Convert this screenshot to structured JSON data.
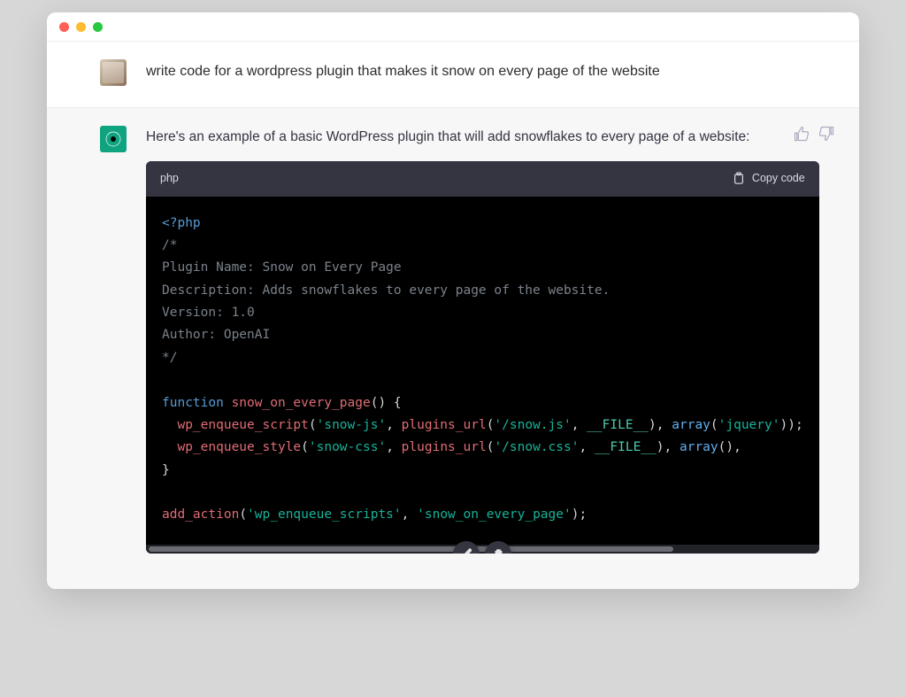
{
  "window": {
    "traffic": [
      "close",
      "minimize",
      "zoom"
    ]
  },
  "user": {
    "text": "write code for a wordpress plugin that makes it snow on every page of the website"
  },
  "assistant": {
    "intro": "Here's an example of a basic WordPress plugin that will add snowflakes to every page of a website:",
    "code": {
      "language": "php",
      "copy_label": "Copy code",
      "tokens": [
        {
          "t": "tag",
          "v": "<?php"
        },
        {
          "t": "nl"
        },
        {
          "t": "cm",
          "v": "/*"
        },
        {
          "t": "nl"
        },
        {
          "t": "cm",
          "v": "Plugin Name: Snow on Every Page"
        },
        {
          "t": "nl"
        },
        {
          "t": "cm",
          "v": "Description: Adds snowflakes to every page of the website."
        },
        {
          "t": "nl"
        },
        {
          "t": "cm",
          "v": "Version: 1.0"
        },
        {
          "t": "nl"
        },
        {
          "t": "cm",
          "v": "Author: OpenAI"
        },
        {
          "t": "nl"
        },
        {
          "t": "cm",
          "v": "*/"
        },
        {
          "t": "nl"
        },
        {
          "t": "nl"
        },
        {
          "t": "kw",
          "v": "function"
        },
        {
          "t": "sp"
        },
        {
          "t": "fn",
          "v": "snow_on_every_page"
        },
        {
          "t": "punct",
          "v": "()"
        },
        {
          "t": "sp"
        },
        {
          "t": "punct",
          "v": "{"
        },
        {
          "t": "nl"
        },
        {
          "t": "indent"
        },
        {
          "t": "call",
          "v": "wp_enqueue_script"
        },
        {
          "t": "punct",
          "v": "("
        },
        {
          "t": "str",
          "v": "'snow-js'"
        },
        {
          "t": "punct",
          "v": ", "
        },
        {
          "t": "call",
          "v": "plugins_url"
        },
        {
          "t": "punct",
          "v": "("
        },
        {
          "t": "str",
          "v": "'/snow.js'"
        },
        {
          "t": "punct",
          "v": ", "
        },
        {
          "t": "const",
          "v": "__FILE__"
        },
        {
          "t": "punct",
          "v": "), "
        },
        {
          "t": "id",
          "v": "array"
        },
        {
          "t": "punct",
          "v": "("
        },
        {
          "t": "str",
          "v": "'jquery'"
        },
        {
          "t": "punct",
          "v": ")"
        },
        {
          "t": "punct",
          "v": ");"
        },
        {
          "t": "nl"
        },
        {
          "t": "indent"
        },
        {
          "t": "call",
          "v": "wp_enqueue_style"
        },
        {
          "t": "punct",
          "v": "("
        },
        {
          "t": "str",
          "v": "'snow-css'"
        },
        {
          "t": "punct",
          "v": ", "
        },
        {
          "t": "call",
          "v": "plugins_url"
        },
        {
          "t": "punct",
          "v": "("
        },
        {
          "t": "str",
          "v": "'/snow.css'"
        },
        {
          "t": "punct",
          "v": ", "
        },
        {
          "t": "const",
          "v": "__FILE__"
        },
        {
          "t": "punct",
          "v": "), "
        },
        {
          "t": "id",
          "v": "array"
        },
        {
          "t": "punct",
          "v": "(), "
        },
        {
          "t": "nl"
        },
        {
          "t": "punct",
          "v": "}"
        },
        {
          "t": "nl"
        },
        {
          "t": "nl"
        },
        {
          "t": "call",
          "v": "add_action"
        },
        {
          "t": "punct",
          "v": "("
        },
        {
          "t": "str",
          "v": "'wp_enqueue_scripts'"
        },
        {
          "t": "punct",
          "v": ", "
        },
        {
          "t": "str",
          "v": "'snow_on_every_page'"
        },
        {
          "t": "punct",
          "v": ");"
        }
      ]
    }
  },
  "feedback": {
    "like": "thumbs-up",
    "dislike": "thumbs-down"
  },
  "tools": {
    "edit": "edit",
    "delete": "delete"
  }
}
